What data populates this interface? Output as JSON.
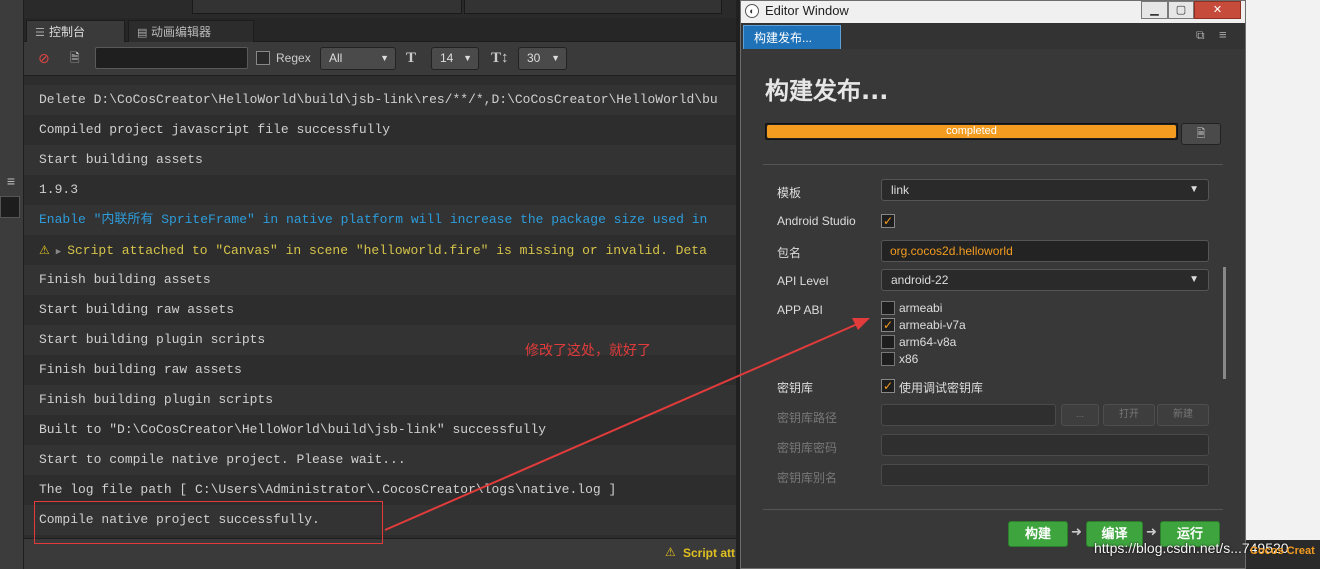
{
  "console": {
    "tabs": [
      {
        "label": "控制台",
        "icon": "console-icon"
      },
      {
        "label": "动画编辑器",
        "icon": "animation-icon"
      }
    ],
    "toolbar": {
      "search_value": "",
      "regex_label": "Regex",
      "level_value": "All",
      "font_size_value": "14",
      "line_count_value": "30"
    },
    "logs": [
      {
        "type": "log",
        "text": "Delete D:\\CoCosCreator\\HelloWorld\\build\\jsb-link\\res/**/*,D:\\CoCosCreator\\HelloWorld\\bu"
      },
      {
        "type": "log",
        "text": "Compiled project javascript file successfully"
      },
      {
        "type": "log",
        "text": "Start building assets"
      },
      {
        "type": "log",
        "text": "1.9.3"
      },
      {
        "type": "info",
        "text": "Enable \"内联所有 SpriteFrame\" in native platform will increase the package size used in"
      },
      {
        "type": "warn",
        "text": "Script attached to \"Canvas\" in scene \"helloworld.fire\" is missing or invalid. Deta"
      },
      {
        "type": "log",
        "text": "Finish building assets"
      },
      {
        "type": "log",
        "text": "Start building raw assets"
      },
      {
        "type": "log",
        "text": "Start building plugin scripts"
      },
      {
        "type": "log",
        "text": "Finish building raw assets"
      },
      {
        "type": "log",
        "text": "Finish building plugin scripts"
      },
      {
        "type": "log",
        "text": "Built to \"D:\\CoCosCreator\\HelloWorld\\build\\jsb-link\" successfully"
      },
      {
        "type": "log",
        "text": "Start to compile native project. Please wait..."
      },
      {
        "type": "log",
        "text": "The log file path [ C:\\Users\\Administrator\\.CocosCreator\\logs\\native.log ]"
      },
      {
        "type": "log",
        "text": "Compile native project successfully."
      }
    ],
    "status_text": "Script att"
  },
  "annotation": {
    "text": "修改了这处，就好了"
  },
  "editor": {
    "window_title": "Editor Window",
    "tab_label": "构建发布...",
    "heading": "构建发布...",
    "progress": {
      "label": "completed",
      "value": 1.0
    },
    "fields": {
      "template_label": "模板",
      "template_value": "link",
      "android_studio_label": "Android Studio",
      "android_studio_checked": true,
      "package_label": "包名",
      "package_value": "org.cocos2d.helloworld",
      "api_label": "API Level",
      "api_value": "android-22",
      "abi_label": "APP ABI",
      "abi_options": [
        {
          "label": "armeabi",
          "checked": false
        },
        {
          "label": "armeabi-v7a",
          "checked": true
        },
        {
          "label": "arm64-v8a",
          "checked": false
        },
        {
          "label": "x86",
          "checked": false
        }
      ],
      "keystore_label": "密钥库",
      "keystore_debug_label": "使用调试密钥库",
      "keystore_debug_checked": true,
      "keystore_path_label": "密钥库路径",
      "keystore_browse": "...",
      "keystore_open": "打开",
      "keystore_new": "新建",
      "keystore_password_label": "密钥库密码",
      "keystore_alias_label": "密钥库别名"
    },
    "buttons": {
      "build": "构建",
      "compile": "编译",
      "run": "运行"
    }
  },
  "watermark": "https://blog.csdn.net/s...749520",
  "right_edge_text": "Cocos Creat",
  "colors": {
    "accent": "#f39c1f",
    "info": "#2d9cdb",
    "warn": "#d6c34a",
    "annotation": "#e23b3b",
    "action": "#3ea43e"
  }
}
